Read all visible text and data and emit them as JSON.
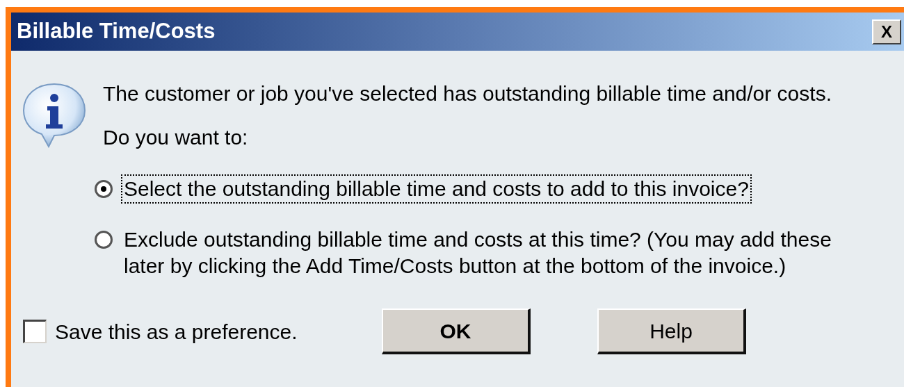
{
  "window": {
    "title": "Billable Time/Costs",
    "close": "X"
  },
  "message": "The customer or job you've selected has outstanding billable time and/or costs.",
  "prompt": "Do you want to:",
  "options": [
    {
      "label": "Select the outstanding billable time and costs to add to this invoice?",
      "selected": true,
      "focused": true
    },
    {
      "label": "Exclude outstanding billable time and costs at this time? (You may add these later by clicking the Add Time/Costs button at the bottom of the invoice.)",
      "selected": false,
      "focused": false
    }
  ],
  "preference": {
    "label": "Save this as a preference.",
    "checked": false
  },
  "buttons": [
    {
      "label": "OK",
      "default": true
    },
    {
      "label": "Help",
      "default": false
    }
  ]
}
